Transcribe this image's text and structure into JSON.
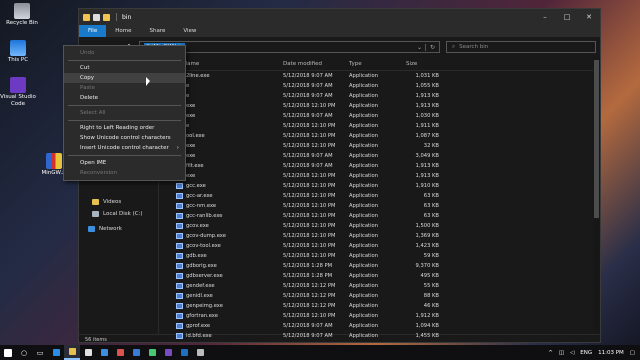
{
  "desktop": {
    "icons": [
      {
        "label": "Recycle Bin"
      },
      {
        "label": "This PC"
      },
      {
        "label": "Visual Studio Code"
      },
      {
        "label": "MinGW.zi"
      }
    ]
  },
  "window": {
    "title": "bin",
    "controls": [
      "–",
      "□",
      "✕"
    ]
  },
  "ribbon": {
    "tabs": [
      "File",
      "Home",
      "Share",
      "View"
    ]
  },
  "address": {
    "selected": "C:\\MinGW\\bin",
    "search_placeholder": "Search bin"
  },
  "nav_pane": {
    "items": [
      {
        "label": "Videos",
        "icon": "folder-icon"
      },
      {
        "label": "Local Disk (C:)",
        "icon": "disk-icon"
      },
      {
        "label": "Network",
        "icon": "network-icon"
      }
    ]
  },
  "columns": {
    "name": "Name",
    "date": "Date modified",
    "type": "Type",
    "size": "Size"
  },
  "files": [
    {
      "name": "2line.exe",
      "date": "5/12/2018 9:07 AM",
      "type": "Application",
      "size": "1,031 KB"
    },
    {
      "name": "e",
      "date": "5/12/2018 9:07 AM",
      "type": "Application",
      "size": "1,055 KB"
    },
    {
      "name": "e",
      "date": "5/12/2018 9:07 AM",
      "type": "Application",
      "size": "1,913 KB"
    },
    {
      "name": "exe",
      "date": "5/12/2018 12:10 PM",
      "type": "Application",
      "size": "1,913 KB"
    },
    {
      "name": "exe",
      "date": "5/12/2018 9:07 AM",
      "type": "Application",
      "size": "1,030 KB"
    },
    {
      "name": "e",
      "date": "5/12/2018 12:10 PM",
      "type": "Application",
      "size": "1,911 KB"
    },
    {
      "name": "ool.exe",
      "date": "5/12/2018 12:10 PM",
      "type": "Application",
      "size": "1,087 KB"
    },
    {
      "name": "exe",
      "date": "5/12/2018 12:10 PM",
      "type": "Application",
      "size": "32 KB"
    },
    {
      "name": "exe",
      "date": "5/12/2018 9:07 AM",
      "type": "Application",
      "size": "3,049 KB"
    },
    {
      "name": "filt.exe",
      "date": "5/12/2018 9:07 AM",
      "type": "Application",
      "size": "1,913 KB"
    },
    {
      "name": "exe",
      "date": "5/12/2018 12:10 PM",
      "type": "Application",
      "size": "1,913 KB"
    },
    {
      "name": "gcc.exe",
      "date": "5/12/2018 12:10 PM",
      "type": "Application",
      "size": "1,910 KB"
    },
    {
      "name": "gcc-ar.exe",
      "date": "5/12/2018 12:10 PM",
      "type": "Application",
      "size": "63 KB"
    },
    {
      "name": "gcc-nm.exe",
      "date": "5/12/2018 12:10 PM",
      "type": "Application",
      "size": "63 KB"
    },
    {
      "name": "gcc-ranlib.exe",
      "date": "5/12/2018 12:10 PM",
      "type": "Application",
      "size": "63 KB"
    },
    {
      "name": "gcov.exe",
      "date": "5/12/2018 12:10 PM",
      "type": "Application",
      "size": "1,500 KB"
    },
    {
      "name": "gcov-dump.exe",
      "date": "5/12/2018 12:10 PM",
      "type": "Application",
      "size": "1,369 KB"
    },
    {
      "name": "gcov-tool.exe",
      "date": "5/12/2018 12:10 PM",
      "type": "Application",
      "size": "1,423 KB"
    },
    {
      "name": "gdb.exe",
      "date": "5/12/2018 12:10 PM",
      "type": "Application",
      "size": "59 KB"
    },
    {
      "name": "gdborig.exe",
      "date": "5/12/2018 1:28 PM",
      "type": "Application",
      "size": "9,370 KB"
    },
    {
      "name": "gdbserver.exe",
      "date": "5/12/2018 1:28 PM",
      "type": "Application",
      "size": "495 KB"
    },
    {
      "name": "gendef.exe",
      "date": "5/12/2018 12:12 PM",
      "type": "Application",
      "size": "55 KB"
    },
    {
      "name": "genidl.exe",
      "date": "5/12/2018 12:12 PM",
      "type": "Application",
      "size": "88 KB"
    },
    {
      "name": "genpeimg.exe",
      "date": "5/12/2018 12:12 PM",
      "type": "Application",
      "size": "46 KB"
    },
    {
      "name": "gfortran.exe",
      "date": "5/12/2018 12:10 PM",
      "type": "Application",
      "size": "1,912 KB"
    },
    {
      "name": "gprof.exe",
      "date": "5/12/2018 9:07 AM",
      "type": "Application",
      "size": "1,094 KB"
    },
    {
      "name": "ld.bfd.exe",
      "date": "5/12/2018 9:07 AM",
      "type": "Application",
      "size": "1,455 KB"
    }
  ],
  "status": {
    "count": "56 items"
  },
  "context_menu": {
    "items": [
      {
        "label": "Undo",
        "disabled": true
      },
      {
        "sep": true
      },
      {
        "label": "Cut",
        "disabled": false
      },
      {
        "label": "Copy",
        "disabled": false,
        "hover": true
      },
      {
        "label": "Paste",
        "disabled": true
      },
      {
        "label": "Delete",
        "disabled": false
      },
      {
        "sep": true
      },
      {
        "label": "Select All",
        "disabled": true
      },
      {
        "sep": true
      },
      {
        "label": "Right to Left Reading order",
        "disabled": false
      },
      {
        "label": "Show Unicode control characters",
        "disabled": false
      },
      {
        "label": "Insert Unicode control character",
        "disabled": false,
        "submenu": true
      },
      {
        "sep": true
      },
      {
        "label": "Open IME",
        "disabled": false
      },
      {
        "label": "Reconversion",
        "disabled": true
      }
    ]
  },
  "taskbar": {
    "tray_lang": "ENG",
    "time": "11:03 PM"
  }
}
